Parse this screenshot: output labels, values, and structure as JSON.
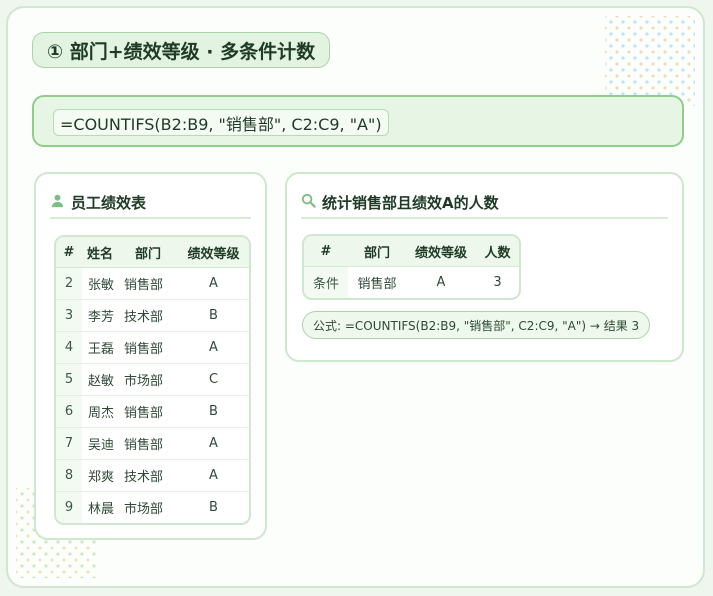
{
  "title": "① 部门+绩效等级 · 多条件计数",
  "formula": "=COUNTIFS(B2:B9, \"销售部\", C2:C9, \"A\")",
  "employee_card": {
    "title": "员工绩效表",
    "headers": [
      "#",
      "姓名",
      "部门",
      "绩效等级"
    ],
    "rows": [
      [
        "2",
        "张敏",
        "销售部",
        "A"
      ],
      [
        "3",
        "李芳",
        "技术部",
        "B"
      ],
      [
        "4",
        "王磊",
        "销售部",
        "A"
      ],
      [
        "5",
        "赵敏",
        "市场部",
        "C"
      ],
      [
        "6",
        "周杰",
        "销售部",
        "B"
      ],
      [
        "7",
        "吴迪",
        "销售部",
        "A"
      ],
      [
        "8",
        "郑爽",
        "技术部",
        "A"
      ],
      [
        "9",
        "林晨",
        "市场部",
        "B"
      ]
    ]
  },
  "stats_card": {
    "title": "统计销售部且绩效A的人数",
    "headers": [
      "#",
      "部门",
      "绩效等级",
      "人数"
    ],
    "row": [
      "条件",
      "销售部",
      "A",
      "3"
    ],
    "summary": "公式: =COUNTIFS(B2:B9, \"销售部\", C2:C9, \"A\") → 结果 3"
  },
  "colors": {
    "accent": "#8fcd8b",
    "background": "#eef6ee",
    "text": "#1f3a26"
  },
  "icons": {
    "employee_card": "user-icon",
    "stats_card": "search-icon"
  }
}
